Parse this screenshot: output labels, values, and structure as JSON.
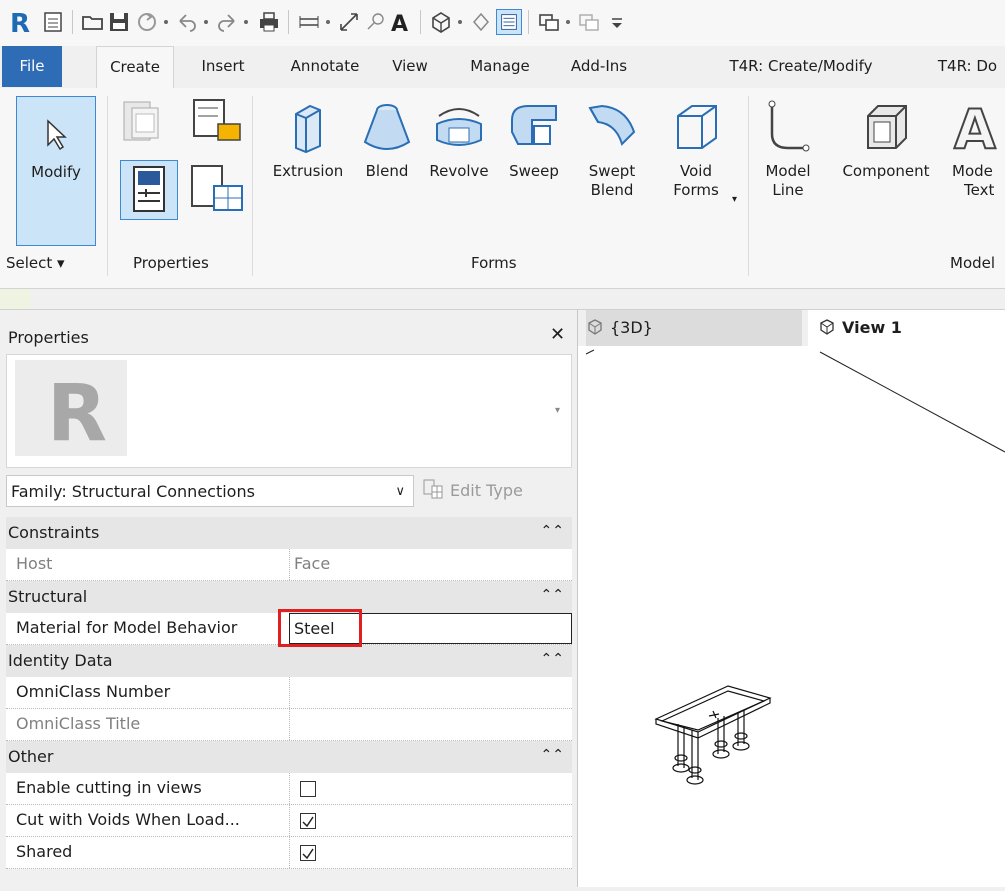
{
  "quick_access": {
    "icons": [
      "revit-app-icon",
      "properties-icon",
      "open-icon",
      "save-icon",
      "sync-icon",
      "undo-icon",
      "redo-icon",
      "print-icon",
      "measure-icon",
      "dimension-icon",
      "tag-icon",
      "text-icon",
      "3d-view-icon",
      "section-icon",
      "thin-lines-icon",
      "switch-windows-icon",
      "close-hidden-icon",
      "customize-icon"
    ]
  },
  "tabs": [
    "File",
    "Create",
    "Insert",
    "Annotate",
    "View",
    "Manage",
    "Add-Ins",
    "T4R: Create/Modify",
    "T4R: Do"
  ],
  "active_tab": "Create",
  "ribbon": {
    "modify_label": "Modify",
    "select_panel": "Select ▾",
    "properties_panel": "Properties",
    "forms_panel": "Forms",
    "model_panel": "Model",
    "forms": {
      "extrusion": "Extrusion",
      "blend": "Blend",
      "revolve": "Revolve",
      "sweep": "Sweep",
      "swept_blend_1": "Swept",
      "swept_blend_2": "Blend",
      "void_forms_1": "Void",
      "void_forms_2": "Forms"
    },
    "model": {
      "model_line_1": "Model",
      "model_line_2": "Line",
      "component": "Component",
      "model_text_1": "Mode",
      "model_text_2": "Text"
    }
  },
  "properties": {
    "title": "Properties",
    "close": "✕",
    "family_selector": "Family: Structural Connections",
    "edit_type": "Edit Type",
    "groups": [
      {
        "name": "Constraints",
        "rows": [
          {
            "label": "Host",
            "value": "Face",
            "dim": true
          }
        ]
      },
      {
        "name": "Structural",
        "rows": [
          {
            "label": "Material for Model Behavior",
            "value": "Steel"
          }
        ]
      },
      {
        "name": "Identity Data",
        "rows": [
          {
            "label": "OmniClass Number",
            "value": ""
          },
          {
            "label": "OmniClass Title",
            "value": "",
            "dim": true
          }
        ]
      },
      {
        "name": "Other",
        "rows": [
          {
            "label": "Enable cutting in views",
            "checked": false
          },
          {
            "label": "Cut with Voids When Load...",
            "checked": true
          },
          {
            "label": "Shared",
            "checked": true
          }
        ]
      }
    ]
  },
  "view_tabs": [
    {
      "label": "{3D}",
      "active": false
    },
    {
      "label": "View 1",
      "active": true
    }
  ],
  "colors": {
    "file_tab": "#2e6cb5",
    "highlight": "#e02020",
    "active_button": "#cce4f7"
  }
}
